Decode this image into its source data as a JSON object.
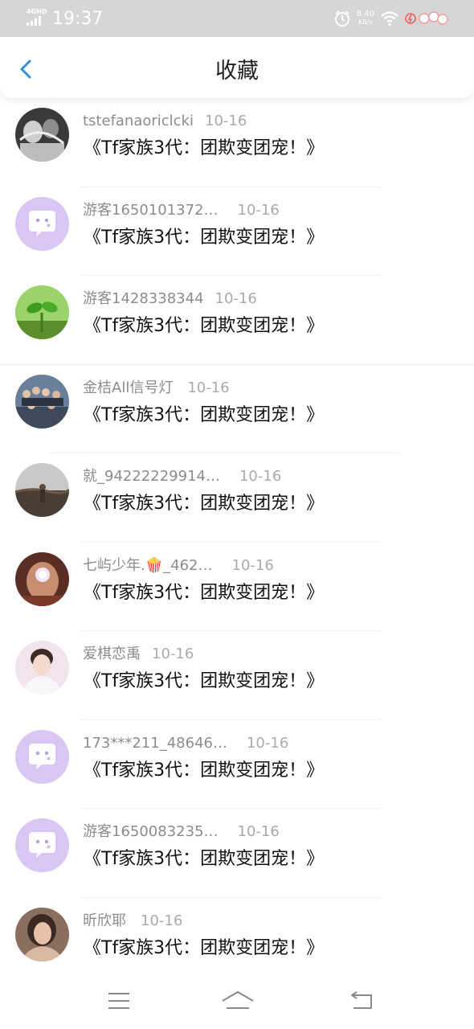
{
  "status_bar": {
    "network": "4GHD",
    "time": "19:37",
    "speed_value": "8.40",
    "speed_unit": "KB/s"
  },
  "header": {
    "title": "收藏"
  },
  "icons": {
    "back": "chevron-left-icon",
    "menu": "menu-icon",
    "home": "home-icon",
    "back_nav": "back-arrow-icon"
  },
  "colors": {
    "accent": "#2f8fe6",
    "guest_avatar": "#d9c6f5",
    "status_bar": "#d6d6d6"
  },
  "items": [
    {
      "user": "tstefanaoriclcki",
      "date": "10-16",
      "title": "《Tf家族3代：团欺变团宠！》",
      "avatar": "photo"
    },
    {
      "user": "游客1650101372…",
      "date": "10-16",
      "title": "《Tf家族3代：团欺变团宠！》",
      "avatar": "guest"
    },
    {
      "user": "游客1428338344",
      "date": "10-16",
      "title": "《Tf家族3代：团欺变团宠！》",
      "avatar": "photo"
    },
    {
      "user": "金桔All信号灯",
      "date": "10-16",
      "title": "《Tf家族3代：团欺变团宠！》",
      "avatar": "photo"
    },
    {
      "user": "就_94222229914…",
      "date": "10-16",
      "title": "《Tf家族3代：团欺变团宠！》",
      "avatar": "photo"
    },
    {
      "user": "七屿少年.🍿_462…",
      "date": "10-16",
      "title": "《Tf家族3代：团欺变团宠！》",
      "avatar": "photo"
    },
    {
      "user": "爱棋恋禹",
      "date": "10-16",
      "title": "《Tf家族3代：团欺变团宠！》",
      "avatar": "photo"
    },
    {
      "user": "173***211_48646…",
      "date": "10-16",
      "title": "《Tf家族3代：团欺变团宠！》",
      "avatar": "guest"
    },
    {
      "user": "游客1650083235…",
      "date": "10-16",
      "title": "《Tf家族3代：团欺变团宠！》",
      "avatar": "guest"
    },
    {
      "user": "昕欣耶",
      "date": "10-16",
      "title": "《Tf家族3代：团欺变团宠！》",
      "avatar": "photo"
    }
  ]
}
